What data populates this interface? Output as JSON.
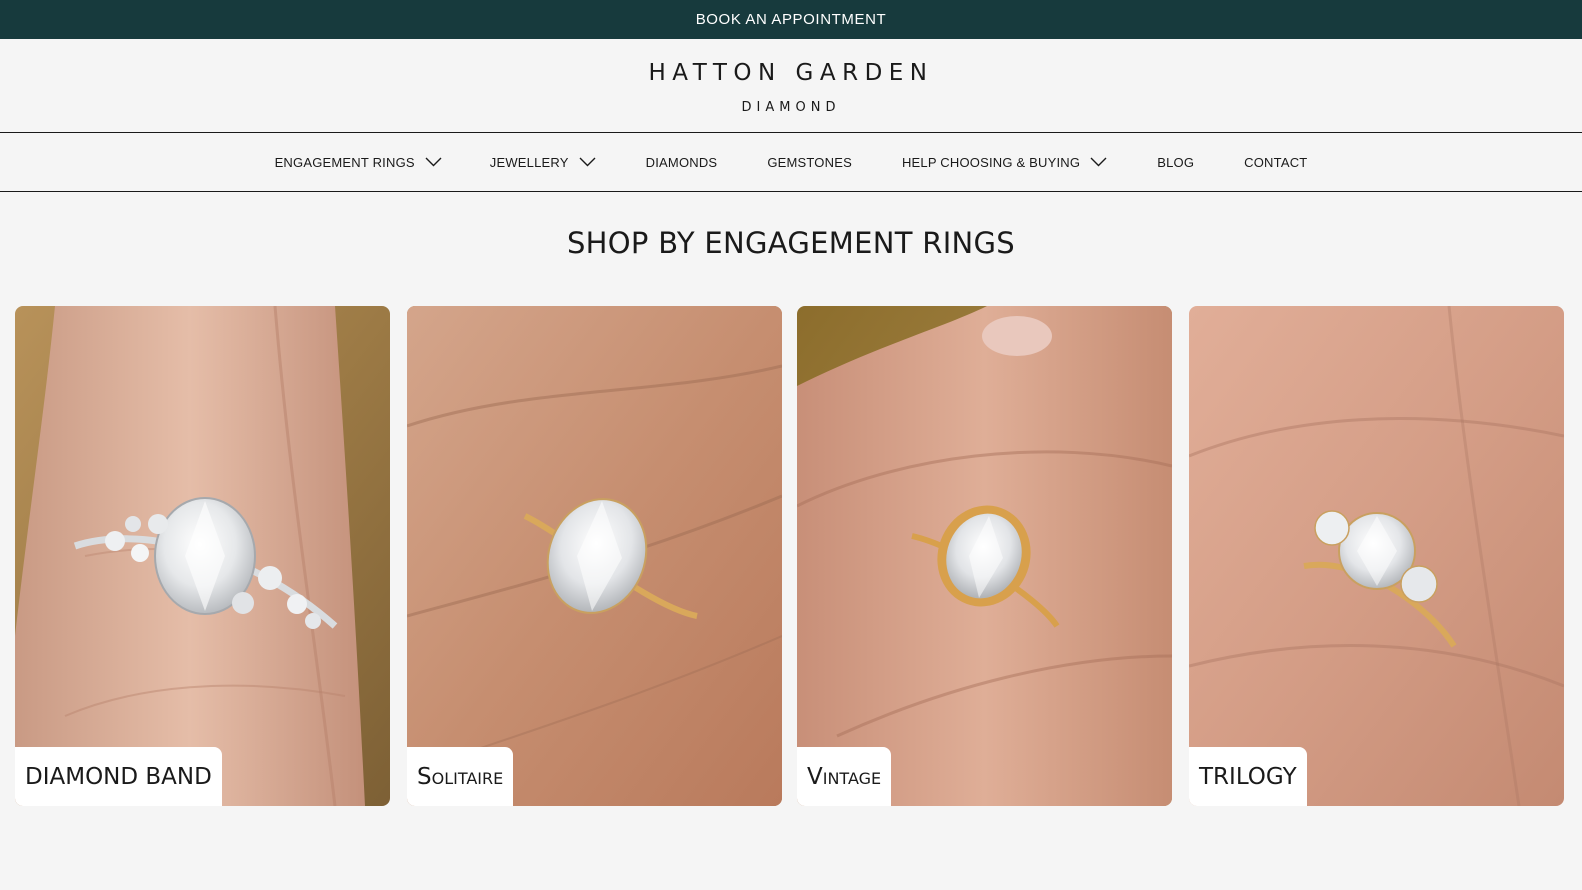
{
  "topbar": {
    "cta_label": "BOOK AN APPOINTMENT",
    "background": "#173a3d"
  },
  "brand": {
    "name": "HATTON GARDEN",
    "sub": "DIAMOND"
  },
  "nav": {
    "items": [
      {
        "label": "ENGAGEMENT RINGS",
        "has_dropdown": true
      },
      {
        "label": "JEWELLERY",
        "has_dropdown": true
      },
      {
        "label": "DIAMONDS",
        "has_dropdown": false
      },
      {
        "label": "GEMSTONES",
        "has_dropdown": false
      },
      {
        "label": "HELP CHOOSING & BUYING",
        "has_dropdown": true
      },
      {
        "label": "BLOG",
        "has_dropdown": false
      },
      {
        "label": "CONTACT",
        "has_dropdown": false
      }
    ]
  },
  "section": {
    "title": "SHOP BY ENGAGEMENT RINGS"
  },
  "categories": [
    {
      "label": "DIAMOND BAND",
      "metal": "white-gold"
    },
    {
      "label": "Solitaire",
      "metal": "yellow-gold"
    },
    {
      "label": "Vintage",
      "metal": "yellow-gold"
    },
    {
      "label": "TRILOGY",
      "metal": "yellow-gold"
    }
  ],
  "icons": {
    "dropdown": "chevron-down-icon"
  }
}
